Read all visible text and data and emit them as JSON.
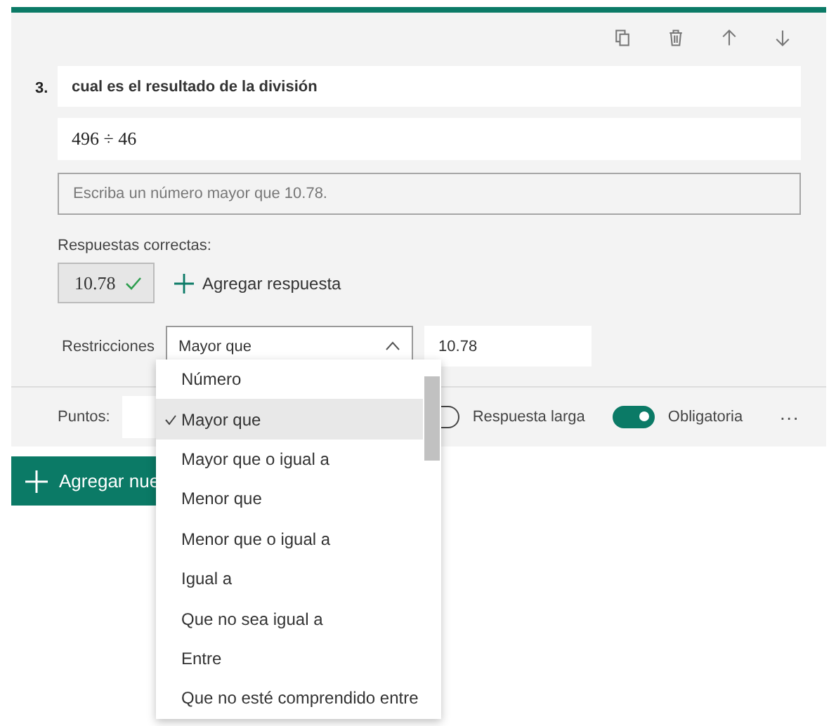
{
  "question": {
    "number": "3.",
    "title": "cual es el resultado de la división",
    "formula": "496 ÷ 46",
    "placeholder": "Escriba un número mayor que 10.78."
  },
  "correct_answers": {
    "label": "Respuestas correctas:",
    "answers": [
      "10.78"
    ],
    "add_label": "Agregar respuesta"
  },
  "restrictions": {
    "label": "Restricciones",
    "selected_value": "Mayor que",
    "value": "10.78",
    "expanded": true,
    "options": [
      {
        "label": "Número",
        "selected": false
      },
      {
        "label": "Mayor que",
        "selected": true
      },
      {
        "label": "Mayor que o igual a",
        "selected": false
      },
      {
        "label": "Menor que",
        "selected": false
      },
      {
        "label": "Menor que o igual a",
        "selected": false
      },
      {
        "label": "Igual a",
        "selected": false
      },
      {
        "label": "Que no sea igual a",
        "selected": false
      },
      {
        "label": "Entre",
        "selected": false
      },
      {
        "label": "Que no esté comprendido entre",
        "selected": false
      }
    ]
  },
  "footer": {
    "points_label": "Puntos:",
    "toggles": [
      {
        "label": "Respuesta larga",
        "on": false
      },
      {
        "label": "Obligatoria",
        "on": true
      }
    ],
    "more": "···"
  },
  "add_button": "Agregar nue"
}
